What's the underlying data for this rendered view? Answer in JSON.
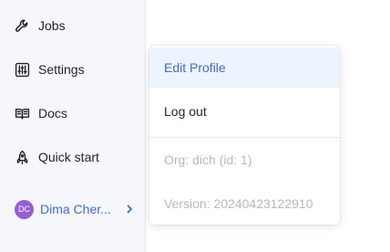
{
  "sidebar": {
    "items": [
      {
        "label": "Jobs",
        "icon": "wrench-icon"
      },
      {
        "label": "Settings",
        "icon": "sliders-icon"
      },
      {
        "label": "Docs",
        "icon": "book-open-icon"
      },
      {
        "label": "Quick start",
        "icon": "rocket-icon"
      }
    ],
    "user": {
      "initials": "DC",
      "name": "Dima Cher...",
      "avatar_color": "#9a5bd8"
    }
  },
  "user_menu": {
    "edit_profile": "Edit Profile",
    "log_out": "Log out",
    "org_info": "Org: dich (id: 1)",
    "version_info": "Version: 20240423122910"
  },
  "colors": {
    "accent": "#3d6ad6",
    "highlight_bg": "#eef4fd",
    "sidebar_bg": "#f6f7fa",
    "muted_text": "#b6b9bf"
  }
}
